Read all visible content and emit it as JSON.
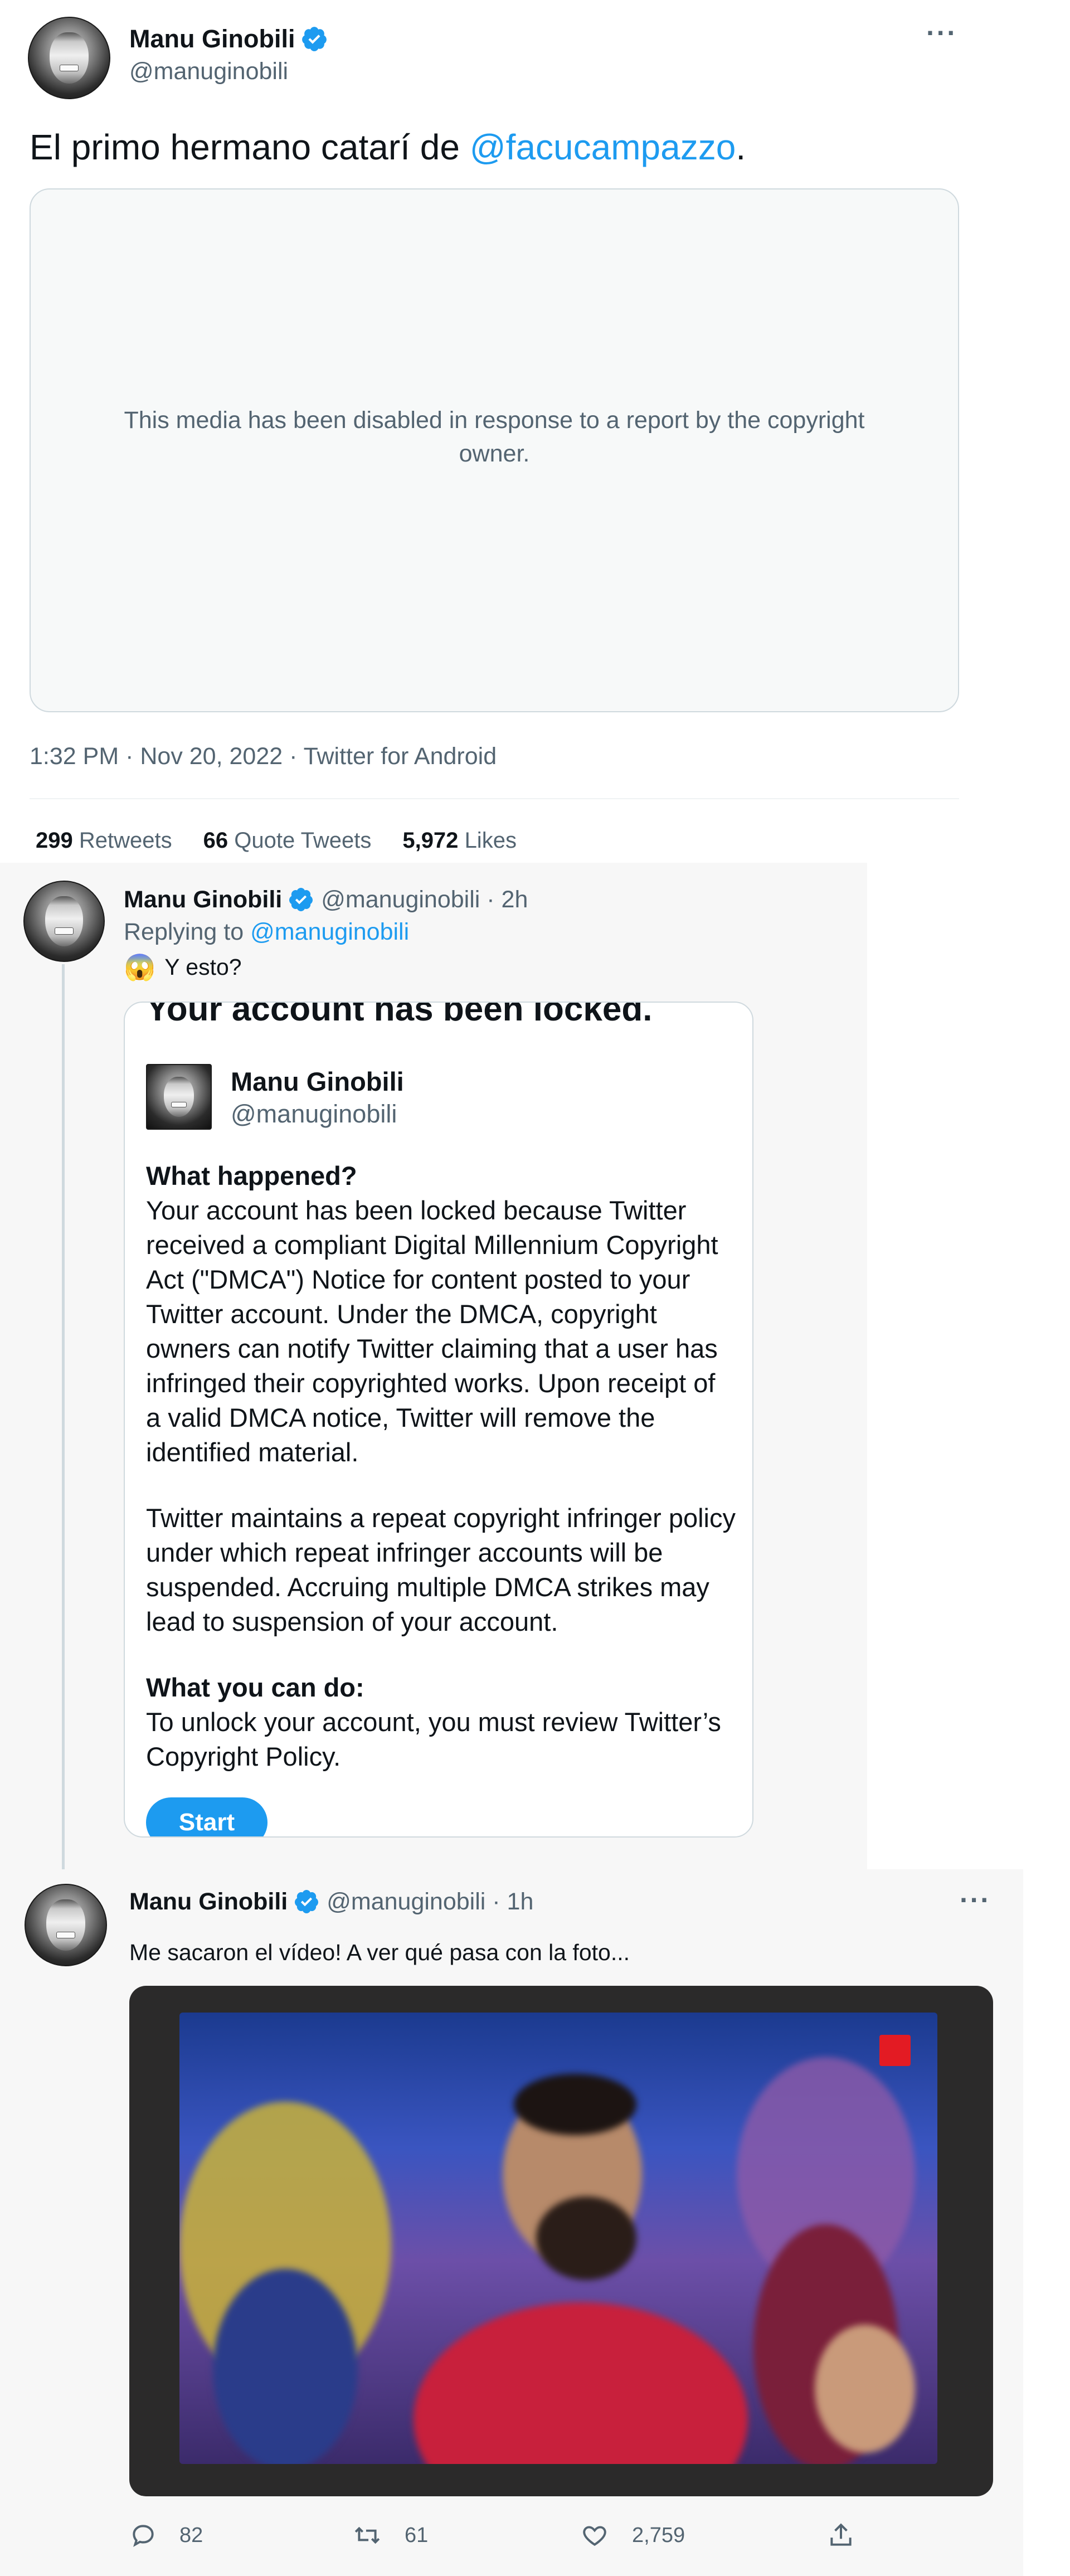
{
  "tweet1": {
    "author_name": "Manu Ginobili",
    "handle": "@manuginobili",
    "more_label": "···",
    "text_prefix": "El primo hermano catarí de ",
    "mention": "@facucampazzo",
    "text_suffix": ".",
    "media_notice": "This media has been disabled in response to a report by the copyright owner.",
    "meta": "1:32 PM · Nov 20, 2022 · Twitter for Android",
    "stats": [
      {
        "count": "299",
        "label": "Retweets"
      },
      {
        "count": "66",
        "label": "Quote Tweets"
      },
      {
        "count": "5,972",
        "label": "Likes"
      }
    ]
  },
  "reply": {
    "author_name": "Manu Ginobili",
    "handle_time": "@manuginobili · 2h",
    "replying_prefix": "Replying to ",
    "replying_handle": "@manuginobili",
    "emoji": "😱",
    "text": "Y esto?",
    "card": {
      "title": "Your account has been locked.",
      "profile_name": "Manu Ginobili",
      "profile_handle": "@manuginobili",
      "section1_heading": "What happened?",
      "section1_body": "Your account has been locked because Twitter received a compliant Digital Millennium Copyright Act (\"DMCA\") Notice for content posted to your Twitter account. Under the DMCA, copyright owners can notify Twitter claiming that a user has infringed their copyrighted works. Upon receipt of a valid DMCA notice, Twitter will remove the identified material.",
      "section1_body2": "Twitter maintains a repeat copyright infringer policy under which repeat infringer accounts will be suspended. Accruing multiple DMCA strikes may lead to suspension of your account.",
      "section2_heading": "What you can do:",
      "section2_body": "To unlock your account, you must review Twitter’s Copyright Policy.",
      "button_label": "Start"
    }
  },
  "tweet3": {
    "author_name": "Manu Ginobili",
    "handle_time": "@manuginobili · 1h",
    "more_label": "···",
    "text": "Me sacaron el vídeo! A ver qué pasa con la foto...",
    "actions": [
      {
        "icon": "reply-icon",
        "count": "82"
      },
      {
        "icon": "retweet-icon",
        "count": "61"
      },
      {
        "icon": "like-icon",
        "count": "2,759"
      },
      {
        "icon": "share-icon",
        "count": ""
      }
    ]
  },
  "colors": {
    "accent": "#1d9bf0",
    "muted": "#536471",
    "border": "#cfd9de"
  }
}
